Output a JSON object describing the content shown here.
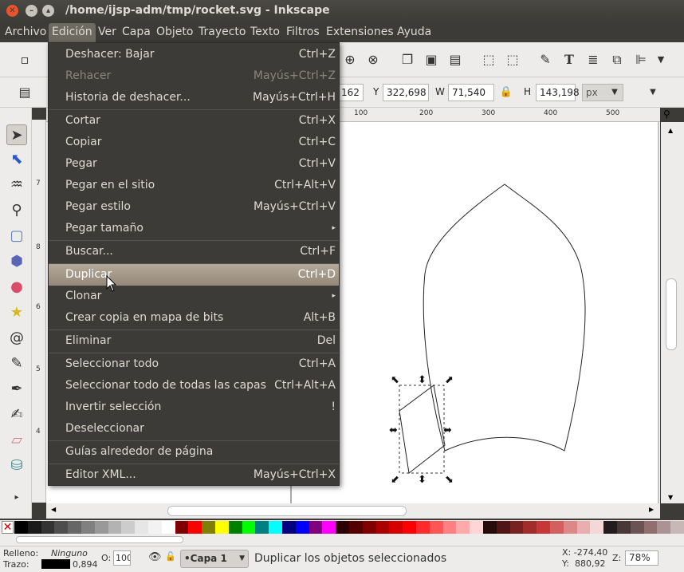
{
  "window": {
    "title": "/home/ijsp-adm/tmp/rocket.svg - Inkscape"
  },
  "menubar": [
    "Archivo",
    "Edición",
    "Ver",
    "Capa",
    "Objeto",
    "Trayecto",
    "Texto",
    "Filtros",
    "Extensiones",
    "Ayuda"
  ],
  "toolbar2": {
    "x_value": "162",
    "y_label": "Y",
    "y_value": "322,698",
    "w_label": "W",
    "w_value": "71,540",
    "h_label": "H",
    "h_value": "143,198",
    "unit": "px"
  },
  "ruler": {
    "h_ticks": [
      "100",
      "200",
      "300",
      "400",
      "500"
    ],
    "v_ticks": [
      "7",
      "8",
      "6",
      "5",
      "4"
    ]
  },
  "edit_menu": [
    {
      "label": "Deshacer: Bajar",
      "accel": "Ctrl+Z"
    },
    {
      "label": "Rehacer",
      "accel": "Mayús+Ctrl+Z",
      "disabled": true
    },
    {
      "label": "Historia de deshacer...",
      "accel": "Mayús+Ctrl+H"
    },
    {
      "label": "Cortar",
      "accel": "Ctrl+X"
    },
    {
      "label": "Copiar",
      "accel": "Ctrl+C"
    },
    {
      "label": "Pegar",
      "accel": "Ctrl+V"
    },
    {
      "label": "Pegar en el sitio",
      "accel": "Ctrl+Alt+V"
    },
    {
      "label": "Pegar estilo",
      "accel": "Mayús+Ctrl+V"
    },
    {
      "label": "Pegar tamaño",
      "accel": "▸"
    },
    {
      "label": "Buscar...",
      "accel": "Ctrl+F"
    },
    {
      "label": "Duplicar",
      "accel": "Ctrl+D",
      "highlighted": true
    },
    {
      "label": "Clonar",
      "accel": "▸"
    },
    {
      "label": "Crear copia en mapa de bits",
      "accel": "Alt+B"
    },
    {
      "label": "Eliminar",
      "accel": "Del"
    },
    {
      "label": "Seleccionar todo",
      "accel": "Ctrl+A"
    },
    {
      "label": "Seleccionar todo de todas las capas",
      "accel": "Ctrl+Alt+A"
    },
    {
      "label": "Invertir selección",
      "accel": "!"
    },
    {
      "label": "Deseleccionar",
      "accel": ""
    },
    {
      "label": "Guías alrededor de página",
      "accel": ""
    },
    {
      "label": "Editor XML...",
      "accel": "Mayús+Ctrl+X"
    }
  ],
  "status": {
    "fill_label": "Relleno:",
    "fill_value": "Ninguno",
    "stroke_label": "Trazo:",
    "stroke_value": "0,894",
    "opacity_label": "O:",
    "opacity_value": "100",
    "layer": "•Capa 1",
    "message": "Duplicar los objetos seleccionados",
    "x_coord": "X: -274,40",
    "y_coord": "Y:  880,92",
    "zoom_label": "Z:",
    "zoom_value": "78%"
  },
  "palette_colors": [
    "#000000",
    "#1a1a1a",
    "#333333",
    "#4d4d4d",
    "#666666",
    "#808080",
    "#999999",
    "#b3b3b3",
    "#cccccc",
    "#e6e6e6",
    "#f2f2f2",
    "#ffffff",
    "#800000",
    "#ff0000",
    "#808000",
    "#ffff00",
    "#008000",
    "#00ff00",
    "#008080",
    "#00ffff",
    "#000080",
    "#0000ff",
    "#800080",
    "#ff00ff",
    "#2b0000",
    "#550000",
    "#800000",
    "#aa0000",
    "#d40000",
    "#ff0000",
    "#ff2a2a",
    "#ff5555",
    "#ff8080",
    "#ffaaaa",
    "#ffd5d5",
    "#280b0b",
    "#501616",
    "#782121",
    "#a02c2c",
    "#c83737",
    "#d35f5f",
    "#de8787",
    "#e9afaf",
    "#f4d7d7",
    "#241c1c",
    "#483737",
    "#6c5353",
    "#916f6f",
    "#ac9393",
    "#c8b7b7"
  ]
}
